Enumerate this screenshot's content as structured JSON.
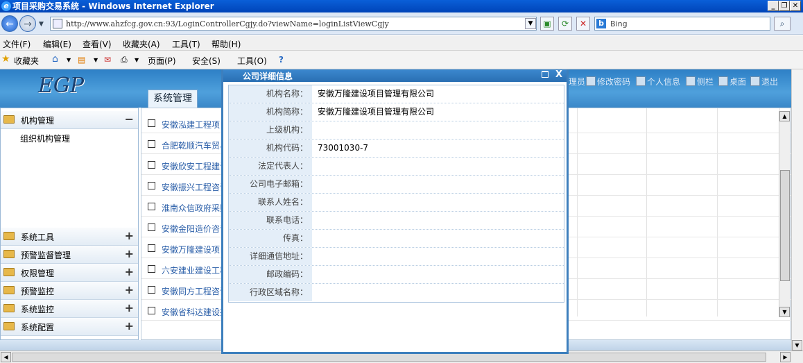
{
  "window": {
    "title": "项目采购交易系统 - Windows Internet Explorer"
  },
  "browser": {
    "url": "http://www.ahzfcg.gov.cn:93/LoginControllerCgjy.do?viewName=loginListViewCgjy",
    "search_text": "Bing",
    "menu": [
      "文件(F)",
      "编辑(E)",
      "查看(V)",
      "收藏夹(A)",
      "工具(T)",
      "帮助(H)"
    ],
    "favorites_label": "收藏夹",
    "tools": {
      "page": "页面(P)",
      "safety": "安全(S)",
      "tools": "工具(O)"
    }
  },
  "app": {
    "logo_text": "EGP",
    "tab_label": "系统管理",
    "header_links": [
      "修改密码",
      "个人信息",
      "侧栏",
      "桌面",
      "退出"
    ],
    "header_clip": "理员"
  },
  "sidebar": {
    "groups": [
      {
        "label": "机构管理",
        "toggle": "−"
      },
      {
        "label": "系统工具",
        "toggle": "+"
      },
      {
        "label": "预警监督管理",
        "toggle": "+"
      },
      {
        "label": "权限管理",
        "toggle": "+"
      },
      {
        "label": "预警监控",
        "toggle": "+"
      },
      {
        "label": "系统监控",
        "toggle": "+"
      },
      {
        "label": "系统配置",
        "toggle": "+"
      }
    ],
    "sub_item": "组织机构管理"
  },
  "grid": {
    "rows": [
      "安徽泓建工程项目",
      "合肥乾顺汽车贸易",
      "安徽欣安工程建设",
      "安徽振兴工程咨询",
      "淮南众信政府采购",
      "安徽金阳造价咨询",
      "安徽万隆建设项目",
      "六安建业建设工程",
      "安徽同方工程咨询",
      "安徽省科达建设投"
    ]
  },
  "modal": {
    "title": "公司详细信息",
    "close": "X",
    "fields": [
      {
        "label": "机构名称：",
        "value": "安徽万隆建设项目管理有限公司"
      },
      {
        "label": "机构简称：",
        "value": "安徽万隆建设项目管理有限公司"
      },
      {
        "label": "上级机构：",
        "value": ""
      },
      {
        "label": "机构代码：",
        "value": "73001030-7"
      },
      {
        "label": "法定代表人：",
        "value": ""
      },
      {
        "label": "公司电子邮箱：",
        "value": ""
      },
      {
        "label": "联系人姓名：",
        "value": ""
      },
      {
        "label": "联系电话：",
        "value": ""
      },
      {
        "label": "传真：",
        "value": ""
      },
      {
        "label": "详细通信地址：",
        "value": ""
      },
      {
        "label": "邮政编码：",
        "value": ""
      },
      {
        "label": "行政区域名称：",
        "value": ""
      }
    ]
  }
}
